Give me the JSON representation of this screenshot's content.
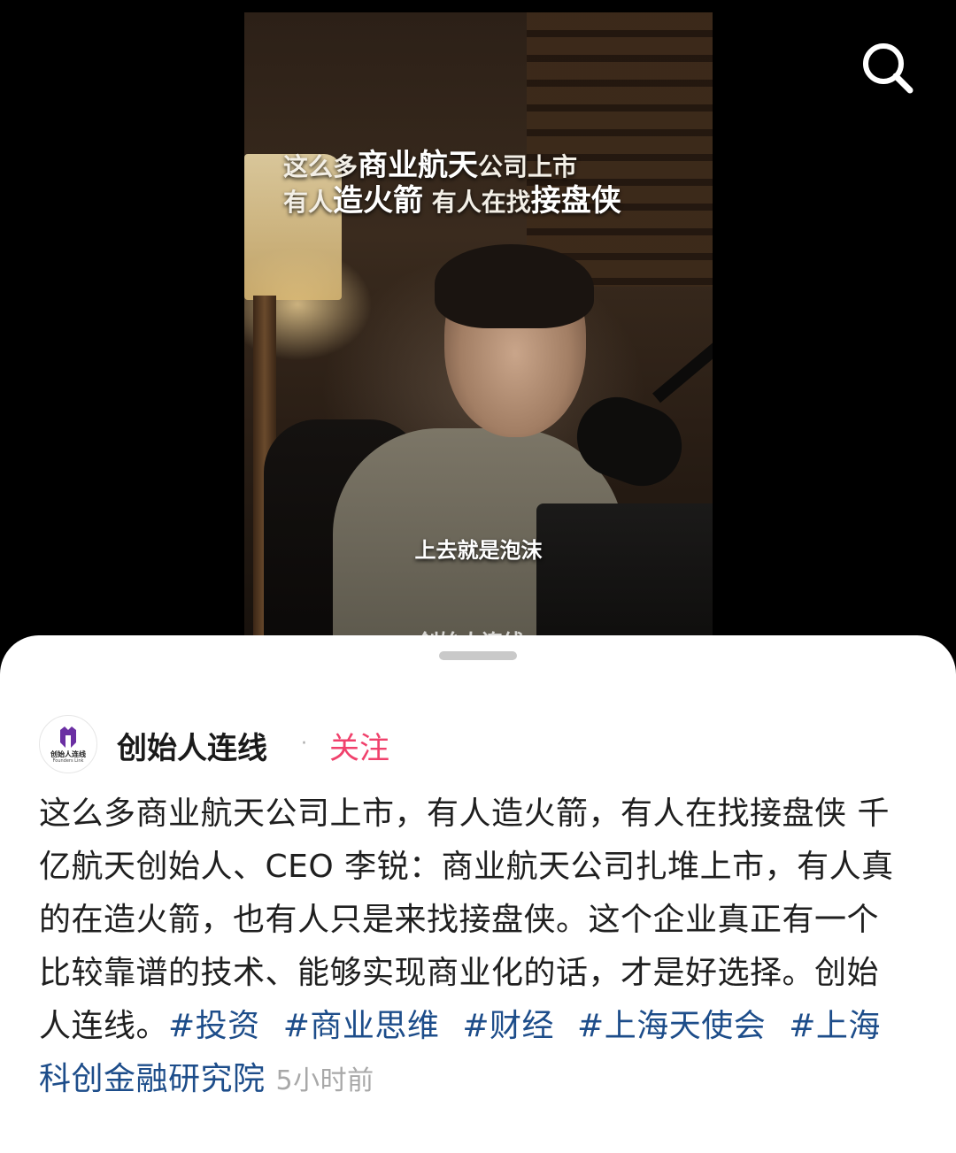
{
  "video": {
    "caption_line1_pre": "这么多",
    "caption_line1_big": "商业航天",
    "caption_line1_post": "公司上市",
    "caption_line2_pre": "有人",
    "caption_line2_big": "造火箭",
    "caption_line2_mid": " 有人在找",
    "caption_line2_gold": "接盘侠",
    "subtitle": "上去就是泡沫",
    "watermark": "创始人连线"
  },
  "author": {
    "name": "创始人连线",
    "follow_label": "关注",
    "avatar_text_cn": "创始人连线",
    "avatar_text_en": "Founders Link"
  },
  "post": {
    "text": "这么多商业航天公司上市，有人造火箭，有人在找接盘侠 千亿航天创始人、CEO 李锐：商业航天公司扎堆上市，有人真的在造火箭，也有人只是来找接盘侠。这个企业真正有一个比较靠谱的技术、能够实现商业化的话，才是好选择。创始人连线。",
    "tags": [
      "#投资",
      "#商业思维",
      "#财经",
      "#上海天使会",
      "#上海科创金融研究院"
    ],
    "time": "5小时前"
  },
  "colors": {
    "follow": "#f0416c",
    "tag": "#1d4d8a",
    "caption_gold": "#ffd54a"
  },
  "icons": {
    "search": "search-icon"
  }
}
